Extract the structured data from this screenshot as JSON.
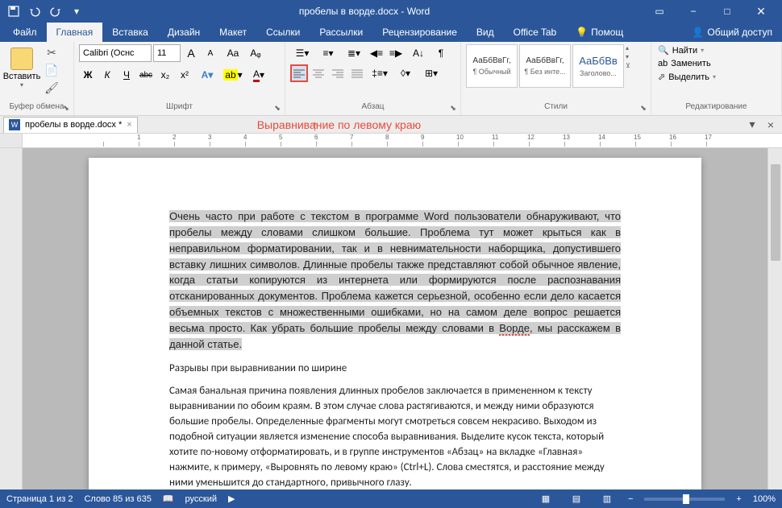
{
  "title": "пробелы в ворде.docx - Word",
  "qat": {
    "save": "save",
    "undo": "undo",
    "redo": "redo"
  },
  "window": {
    "min": "−",
    "max": "□",
    "close": "×",
    "ribbon_opts": "▭"
  },
  "tabs": {
    "file": "Файл",
    "home": "Главная",
    "insert": "Вставка",
    "design": "Дизайн",
    "layout": "Макет",
    "references": "Ссылки",
    "mailings": "Рассылки",
    "review": "Рецензирование",
    "view": "Вид",
    "office_tab": "Office Tab",
    "help": "Помощ",
    "share": "Общий доступ"
  },
  "ribbon": {
    "clipboard": {
      "label": "Буфер обмена",
      "paste": "Вставить"
    },
    "font": {
      "label": "Шрифт",
      "name": "Calibri (Оснс",
      "size": "11",
      "bold": "Ж",
      "italic": "К",
      "underline": "Ч",
      "strike": "abc",
      "sub": "x₂",
      "sup": "x²",
      "grow": "A",
      "shrink": "A",
      "case": "Aa",
      "clear": "⌫"
    },
    "paragraph": {
      "label": "Абзац"
    },
    "styles": {
      "label": "Стили",
      "preview": "АаБбВвГг,",
      "preview_blue": "АаБбВв",
      "s1": "¶ Обычный",
      "s2": "¶ Без инте...",
      "s3": "Заголово..."
    },
    "editing": {
      "label": "Редактирование",
      "find": "Найти",
      "replace": "Заменить",
      "select": "Выделить"
    }
  },
  "annotation": {
    "arrow": "↑",
    "text": "Выравнивание по левому краю"
  },
  "doc_tab": {
    "name": "пробелы в ворде.docx *",
    "close": "×"
  },
  "ruler_ticks": [
    "",
    "1",
    "2",
    "3",
    "4",
    "5",
    "6",
    "7",
    "8",
    "9",
    "10",
    "11",
    "12",
    "13",
    "14",
    "15",
    "16",
    "17"
  ],
  "document": {
    "p1_sel": "Очень часто при работе с текстом в программе Word пользователи обнаруживают, что пробелы между словами слишком большие. Проблема тут может крыться как в неправильном форматировании, так и в невнимательности наборщика, допустившего вставку лишних символов. Длинные пробелы также представляют собой обычное явление, когда статьи копируются из интернета или формируются после распознавания отсканированных документов. Проблема кажется серьезной, особенно если дело касается объемных текстов с множественными ошибками, но на самом деле вопрос решается весьма просто. Как убрать большие пробелы между словами в ",
    "p1_err": "Ворде",
    "p1_end": ", мы расскажем в данной статье.",
    "p2": "Разрывы при выравнивании по ширине",
    "p3": "Самая банальная причина появления длинных пробелов заключается в примененном к тексту выравнивании по обоим краям. В этом случае слова растягиваются, и между ними образуются большие пробелы. Определенные фрагменты могут смотреться совсем некрасиво. Выходом из подобной ситуации является изменение способа выравнивания. Выделите кусок текста, который хотите по-новому отформатировать, и в группе инструментов «Абзац» на вкладке «Главная» нажмите, к примеру, «Выровнять по левому краю» (Ctrl+L). Слова сместятся, и расстояние между ними уменьшится до стандартного, привычного глазу."
  },
  "status": {
    "page": "Страница 1 из 2",
    "words": "Слово 85 из 635",
    "lang": "русский",
    "zoom": "100%"
  }
}
